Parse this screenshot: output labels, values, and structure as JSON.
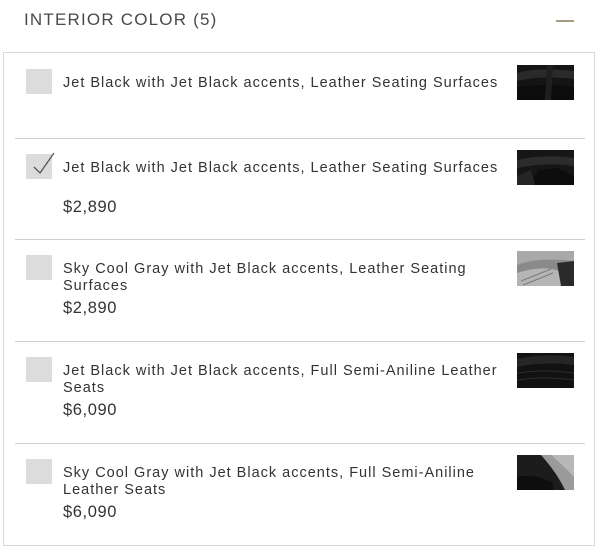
{
  "section": {
    "title": "INTERIOR COLOR (5)"
  },
  "options": [
    {
      "label": "Jet Black with Jet Black accents, Leather Seating Surfaces",
      "price": "",
      "selected": false,
      "swatch": "jet-black-leather-swatch"
    },
    {
      "label": "Jet Black with Jet Black accents, Leather Seating Surfaces",
      "price": "$2,890",
      "selected": true,
      "swatch": "jet-black-leather-swatch"
    },
    {
      "label": "Sky Cool Gray with Jet Black accents, Leather Seating Surfaces",
      "price": "$2,890",
      "selected": false,
      "swatch": "sky-cool-gray-leather-swatch"
    },
    {
      "label": "Jet Black with Jet Black accents, Full Semi-Aniline Leather Seats",
      "price": "$6,090",
      "selected": false,
      "swatch": "jet-black-semi-aniline-swatch"
    },
    {
      "label": "Sky Cool Gray with Jet Black accents, Full Semi-Aniline Leather Seats",
      "price": "$6,090",
      "selected": false,
      "swatch": "sky-cool-gray-semi-aniline-swatch"
    }
  ],
  "colors": {
    "accent": "#a69c7e",
    "checkbox": "#dcdcdc",
    "divider": "#cfcfcf"
  }
}
